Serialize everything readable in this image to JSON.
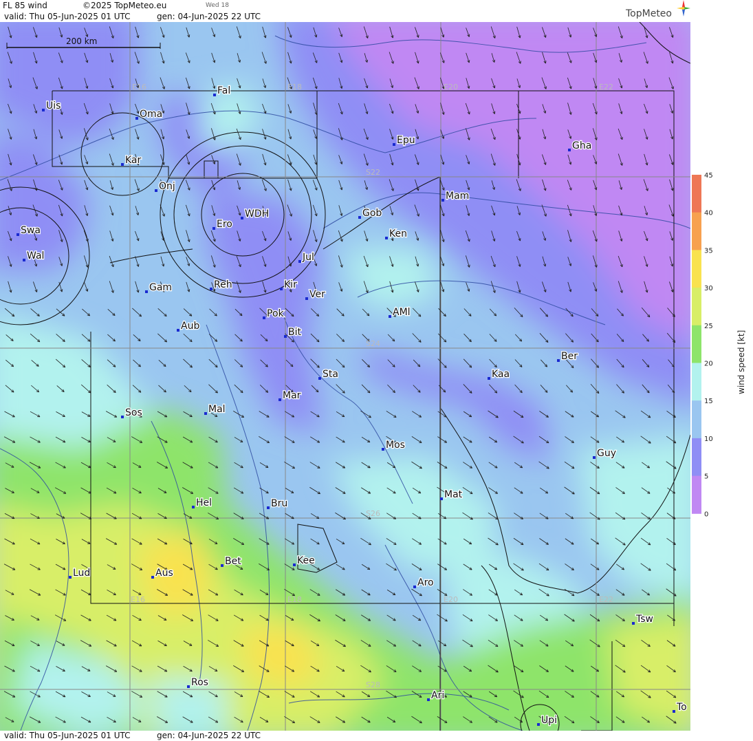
{
  "header": {
    "product": "FL 85 wind",
    "copyright": "©2025 TopMeteo.eu",
    "day": "Wed 18",
    "valid": "valid:  Thu  05-Jun-2025  01 UTC",
    "gen": "gen: 04-Jun-2025 22 UTC"
  },
  "footer": {
    "valid": "valid:  Thu  05-Jun-2025  01 UTC",
    "gen": "gen: 04-Jun-2025 22 UTC"
  },
  "logo": "TopMeteo",
  "scale_bar": "200 km",
  "colorbar": {
    "label": "wind speed  [kt]",
    "ticks": [
      "45",
      "40",
      "35",
      "30",
      "25",
      "20",
      "15",
      "10",
      "5",
      "0"
    ],
    "colors": [
      "#ee7755",
      "#f7a14f",
      "#f9e24f",
      "#d8ee67",
      "#8ee46a",
      "#b2f2ee",
      "#9ac6f0",
      "#8f8ef5",
      "#c088f3"
    ]
  },
  "grid_labels": {
    "lon_top": [
      "E16",
      "E18",
      "E20",
      "E22"
    ],
    "lon_bottom": [
      "E16",
      "E18",
      "E20",
      "E22"
    ],
    "lat": [
      "S22",
      "S24",
      "S26",
      "S28"
    ]
  },
  "places": [
    {
      "name": "Uis"
    },
    {
      "name": "Oma"
    },
    {
      "name": "Fal"
    },
    {
      "name": "Kar"
    },
    {
      "name": "Epu"
    },
    {
      "name": "Gha"
    },
    {
      "name": "Onj"
    },
    {
      "name": "Mam"
    },
    {
      "name": "Swa"
    },
    {
      "name": "Gob"
    },
    {
      "name": "WDH"
    },
    {
      "name": "Ero"
    },
    {
      "name": "Ken"
    },
    {
      "name": "Wal"
    },
    {
      "name": "Jul"
    },
    {
      "name": "Gam"
    },
    {
      "name": "Reh"
    },
    {
      "name": "Kir"
    },
    {
      "name": "Ver"
    },
    {
      "name": "AMl"
    },
    {
      "name": "Pok"
    },
    {
      "name": "Aub"
    },
    {
      "name": "Bit"
    },
    {
      "name": "Ber"
    },
    {
      "name": "Sta"
    },
    {
      "name": "Kaa"
    },
    {
      "name": "Mar"
    },
    {
      "name": "Sos"
    },
    {
      "name": "Mal"
    },
    {
      "name": "Mos"
    },
    {
      "name": "Guy"
    },
    {
      "name": "Mat"
    },
    {
      "name": "Hel"
    },
    {
      "name": "Bru"
    },
    {
      "name": "Bet"
    },
    {
      "name": "Kee"
    },
    {
      "name": "Lud"
    },
    {
      "name": "Aus"
    },
    {
      "name": "Aro"
    },
    {
      "name": "Tsw"
    },
    {
      "name": "Ros"
    },
    {
      "name": "Ari"
    },
    {
      "name": "Upi"
    },
    {
      "name": "To"
    }
  ]
}
